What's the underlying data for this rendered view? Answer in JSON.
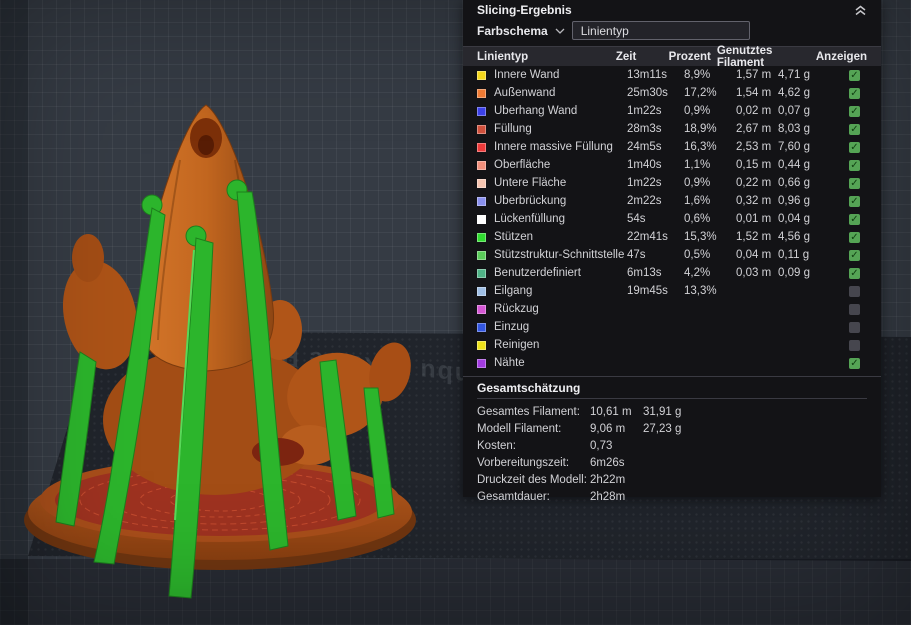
{
  "viewport": {
    "plate_label": "Bambu Texture PEI"
  },
  "icons": {
    "check": "✓"
  },
  "colors": {
    "checkbox_on": "#55A455",
    "checkbox_off": "#46464E",
    "model_orange": "#B5561C",
    "support_green": "#2CB52C"
  },
  "panel": {
    "title": "Slicing-Ergebnis",
    "color_scheme": {
      "label": "Farbschema",
      "value": "Linientyp"
    },
    "table": {
      "headers": {
        "type": "Linientyp",
        "time": "Zeit",
        "percent": "Prozent",
        "filament": "Genutztes Filament",
        "show": "Anzeigen"
      },
      "rows": [
        {
          "label": "Innere Wand",
          "color": "#F4D71C",
          "time": "13m11s",
          "percent": "8,9%",
          "filament_m": "1,57 m",
          "filament_g": "4,71 g",
          "checked": true
        },
        {
          "label": "Außenwand",
          "color": "#EE7A34",
          "time": "25m30s",
          "percent": "17,2%",
          "filament_m": "1,54 m",
          "filament_g": "4,62 g",
          "checked": true
        },
        {
          "label": "Überhang Wand",
          "color": "#3C41E8",
          "time": "1m22s",
          "percent": "0,9%",
          "filament_m": "0,02 m",
          "filament_g": "0,07 g",
          "checked": true
        },
        {
          "label": "Füllung",
          "color": "#D0503C",
          "time": "28m3s",
          "percent": "18,9%",
          "filament_m": "2,67 m",
          "filament_g": "8,03 g",
          "checked": true
        },
        {
          "label": "Innere massive Füllung",
          "color": "#EE3A3A",
          "time": "24m5s",
          "percent": "16,3%",
          "filament_m": "2,53 m",
          "filament_g": "7,60 g",
          "checked": true
        },
        {
          "label": "Oberfläche",
          "color": "#F2907C",
          "time": "1m40s",
          "percent": "1,1%",
          "filament_m": "0,15 m",
          "filament_g": "0,44 g",
          "checked": true
        },
        {
          "label": "Untere Fläche",
          "color": "#F6C4B0",
          "time": "1m22s",
          "percent": "0,9%",
          "filament_m": "0,22 m",
          "filament_g": "0,66 g",
          "checked": true
        },
        {
          "label": "Überbrückung",
          "color": "#8A90EE",
          "time": "2m22s",
          "percent": "1,6%",
          "filament_m": "0,32 m",
          "filament_g": "0,96 g",
          "checked": true
        },
        {
          "label": "Lückenfüllung",
          "color": "#FFFFFF",
          "time": "54s",
          "percent": "0,6%",
          "filament_m": "0,01 m",
          "filament_g": "0,04 g",
          "checked": true
        },
        {
          "label": "Stützen",
          "color": "#31DC31",
          "time": "22m41s",
          "percent": "15,3%",
          "filament_m": "1,52 m",
          "filament_g": "4,56 g",
          "checked": true
        },
        {
          "label": "Stützstruktur-Schnittstelle",
          "color": "#5ACC5A",
          "time": "47s",
          "percent": "0,5%",
          "filament_m": "0,04 m",
          "filament_g": "0,11 g",
          "checked": true
        },
        {
          "label": "Benutzerdefiniert",
          "color": "#4FB286",
          "time": "6m13s",
          "percent": "4,2%",
          "filament_m": "0,03 m",
          "filament_g": "0,09 g",
          "checked": true
        },
        {
          "label": "Eilgang",
          "color": "#9FBFE5",
          "time": "19m45s",
          "percent": "13,3%",
          "filament_m": "",
          "filament_g": "",
          "checked": false
        },
        {
          "label": "Rückzug",
          "color": "#D457D4",
          "time": "",
          "percent": "",
          "filament_m": "",
          "filament_g": "",
          "checked": false
        },
        {
          "label": "Einzug",
          "color": "#3356E0",
          "time": "",
          "percent": "",
          "filament_m": "",
          "filament_g": "",
          "checked": false
        },
        {
          "label": "Reinigen",
          "color": "#EDE21A",
          "time": "",
          "percent": "",
          "filament_m": "",
          "filament_g": "",
          "checked": false
        },
        {
          "label": "Nähte",
          "color": "#A23BE0",
          "time": "",
          "percent": "",
          "filament_m": "",
          "filament_g": "",
          "checked": true
        }
      ]
    },
    "summary": {
      "title": "Gesamtschätzung",
      "rows": [
        {
          "label": "Gesamtes Filament:",
          "value1": "10,61 m",
          "value2": "31,91 g"
        },
        {
          "label": "Modell Filament:",
          "value1": "9,06 m",
          "value2": "27,23 g"
        },
        {
          "label": "Kosten:",
          "value1": "0,73",
          "value2": ""
        },
        {
          "label": "Vorbereitungszeit:",
          "value1": "6m26s",
          "value2": ""
        },
        {
          "label": "Druckzeit des Modell:",
          "value1": "2h22m",
          "value2": ""
        },
        {
          "label": "Gesamtdauer:",
          "value1": "2h28m",
          "value2": ""
        }
      ]
    }
  }
}
